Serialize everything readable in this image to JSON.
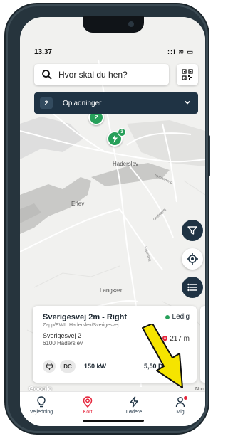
{
  "status_bar": {
    "time": "13.37",
    "icons_text": "::! ≋ ▭"
  },
  "search": {
    "placeholder": "Hvor skal du hen?"
  },
  "charging_bar": {
    "count": "2",
    "label": "Opladninger"
  },
  "map": {
    "labels": {
      "haderslev": "Haderslev",
      "erlev": "Erlev",
      "langkaer": "Langkær"
    },
    "road_labels": {
      "sythanneng": "Sythanneng",
      "gettingvej": "Gettingvej",
      "vojensvej": "Vojensvej"
    },
    "markers": [
      {
        "value": "2"
      },
      {
        "value": "",
        "sub": "3"
      }
    ],
    "attribution": "Google",
    "corner_label": "Norr"
  },
  "station_card": {
    "name": "Sverigesvej 2m - Right",
    "status": "Ledig",
    "operator": "Zapp/EWII: Haderslev/Sverigesvej",
    "street": "Sverigesvej 2",
    "city": "6100 Haderslev",
    "distance": "217 m",
    "connector_type": "DC",
    "power": "150 kW",
    "price": "5,50 D",
    "price_unit": "Wh"
  },
  "tabbar": {
    "tabs": [
      {
        "label": "Vejledning",
        "icon": "lightbulb-icon",
        "active": false
      },
      {
        "label": "Kort",
        "icon": "location-pin-icon",
        "active": true
      },
      {
        "label": "Lødere",
        "icon": "lightning-icon",
        "active": false
      },
      {
        "label": "Mig",
        "icon": "user-icon",
        "active": false,
        "badge": true
      }
    ]
  },
  "colors": {
    "accent_navy": "#1f3344",
    "available_green": "#27a05a",
    "active_red": "#e5263c",
    "arrow_yellow": "#f5e400"
  }
}
